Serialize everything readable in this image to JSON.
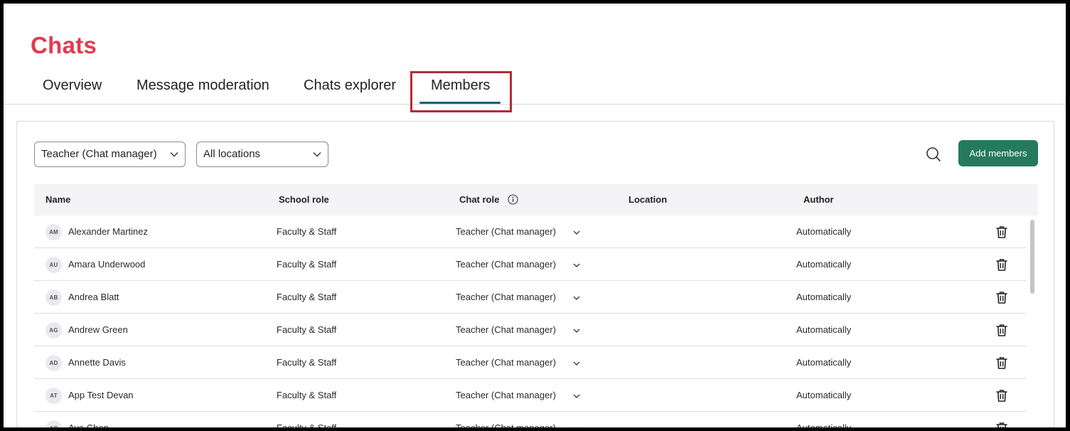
{
  "page_title": "Chats",
  "tabs": [
    {
      "label": "Overview",
      "active": false
    },
    {
      "label": "Message moderation",
      "active": false
    },
    {
      "label": "Chats explorer",
      "active": false
    },
    {
      "label": "Members",
      "active": true
    }
  ],
  "filters": {
    "role_value": "Teacher (Chat manager)",
    "location_value": "All locations"
  },
  "toolbar": {
    "search_icon": "search-icon",
    "add_members_label": "Add members"
  },
  "table": {
    "headers": {
      "name": "Name",
      "school_role": "School role",
      "chat_role": "Chat role",
      "location": "Location",
      "author": "Author"
    },
    "rows": [
      {
        "initials": "AM",
        "name": "Alexander Martinez",
        "school_role": "Faculty & Staff",
        "chat_role": "Teacher (Chat manager)",
        "location": "",
        "author": "Automatically"
      },
      {
        "initials": "AU",
        "name": "Amara Underwood",
        "school_role": "Faculty & Staff",
        "chat_role": "Teacher (Chat manager)",
        "location": "",
        "author": "Automatically"
      },
      {
        "initials": "AB",
        "name": "Andrea Blatt",
        "school_role": "Faculty & Staff",
        "chat_role": "Teacher (Chat manager)",
        "location": "",
        "author": "Automatically"
      },
      {
        "initials": "AG",
        "name": "Andrew Green",
        "school_role": "Faculty & Staff",
        "chat_role": "Teacher (Chat manager)",
        "location": "",
        "author": "Automatically"
      },
      {
        "initials": "AD",
        "name": "Annette Davis",
        "school_role": "Faculty & Staff",
        "chat_role": "Teacher (Chat manager)",
        "location": "",
        "author": "Automatically"
      },
      {
        "initials": "AT",
        "name": "App Test Devan",
        "school_role": "Faculty & Staff",
        "chat_role": "Teacher (Chat manager)",
        "location": "",
        "author": "Automatically"
      },
      {
        "initials": "AC",
        "name": "Ava Chen",
        "school_role": "Faculty & Staff",
        "chat_role": "Teacher (Chat manager)",
        "location": "",
        "author": "Automatically"
      }
    ]
  },
  "colors": {
    "title": "#e23b4e",
    "tab_underline": "#235e7a",
    "highlight_box": "#b42c35",
    "primary_button": "#257a5e"
  }
}
